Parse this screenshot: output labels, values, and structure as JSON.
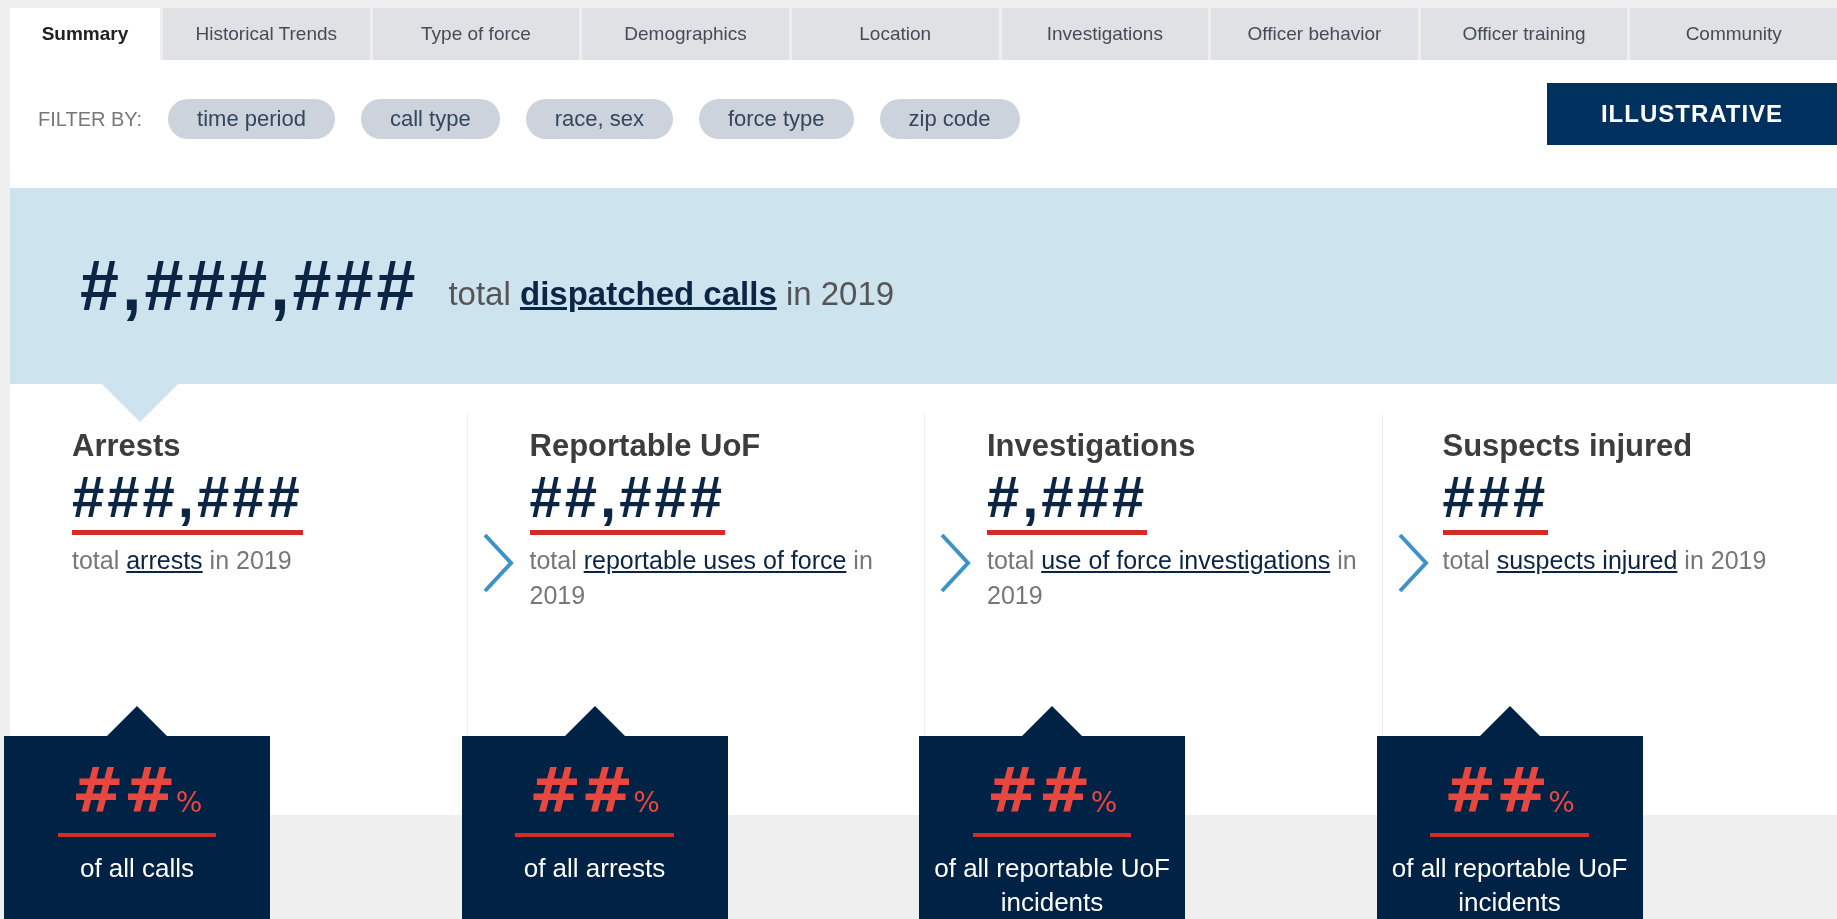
{
  "tabs": [
    {
      "label": "Summary",
      "selected": true
    },
    {
      "label": "Historical Trends",
      "selected": false
    },
    {
      "label": "Type of force",
      "selected": false
    },
    {
      "label": "Demographics",
      "selected": false
    },
    {
      "label": "Location",
      "selected": false
    },
    {
      "label": "Investigations",
      "selected": false
    },
    {
      "label": "Officer behavior",
      "selected": false
    },
    {
      "label": "Officer training",
      "selected": false
    },
    {
      "label": "Community",
      "selected": false
    }
  ],
  "filter": {
    "label": "FILTER BY:",
    "chips": [
      "time period",
      "call type",
      "race, sex",
      "force type",
      "zip code"
    ]
  },
  "illustrative_button": "ILLUSTRATIVE",
  "headline": {
    "number": "#,###,###",
    "prefix": "total",
    "link": "dispatched calls",
    "suffix": "in 2019"
  },
  "metrics": [
    {
      "title": "Arrests",
      "number": "###,###",
      "prefix": "total",
      "link": "arrests",
      "suffix": "in 2019",
      "percent": "##",
      "percent_sign": "%",
      "percent_caption": "of all calls"
    },
    {
      "title": "Reportable UoF",
      "number": "##,###",
      "prefix": "total",
      "link": "reportable uses of force",
      "suffix": "in 2019",
      "percent": "##",
      "percent_sign": "%",
      "percent_caption": "of all arrests"
    },
    {
      "title": "Investigations",
      "number": "#,###",
      "prefix": "total",
      "link": "use of force investigations",
      "suffix": "in 2019",
      "percent": "##",
      "percent_sign": "%",
      "percent_caption": "of all reportable UoF incidents"
    },
    {
      "title": "Suspects injured",
      "number": "###",
      "prefix": "total",
      "link": "suspects injured",
      "suffix": "in 2019",
      "percent": "##",
      "percent_sign": "%",
      "percent_caption": "of all reportable UoF incidents"
    }
  ]
}
